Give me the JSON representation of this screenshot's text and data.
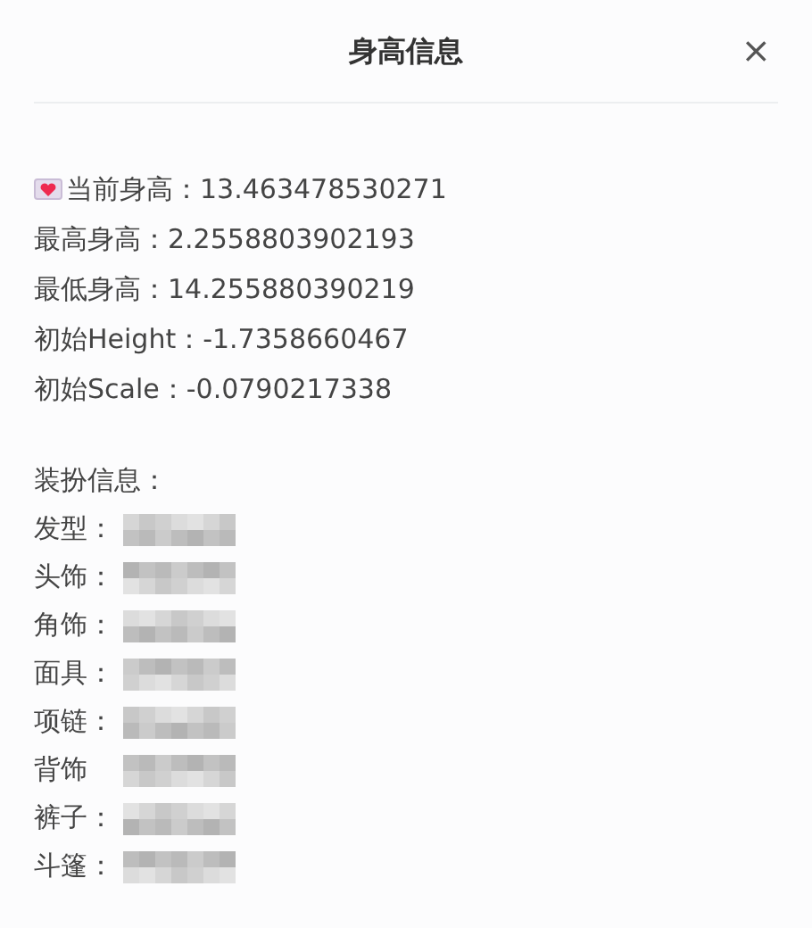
{
  "dialog": {
    "title": "身高信息",
    "close": "×"
  },
  "height_lines": [
    {
      "kind": "icon",
      "text": "当前身高：13.463478530271"
    },
    {
      "kind": "plain",
      "text": "最高身高：2.2558803902193"
    },
    {
      "kind": "plain",
      "text": "最低身高：14.255880390219"
    },
    {
      "kind": "plain",
      "text": "初始Height：-1.7358660467"
    },
    {
      "kind": "plain",
      "text": "初始Scale：-0.0790217338"
    }
  ],
  "outfit": {
    "heading": "装扮信息：",
    "items": [
      {
        "label": "发型："
      },
      {
        "label": "头饰："
      },
      {
        "label": "角饰："
      },
      {
        "label": "面具："
      },
      {
        "label": "项链："
      },
      {
        "label": "背饰"
      },
      {
        "label": "裤子："
      },
      {
        "label": "斗篷："
      }
    ]
  }
}
